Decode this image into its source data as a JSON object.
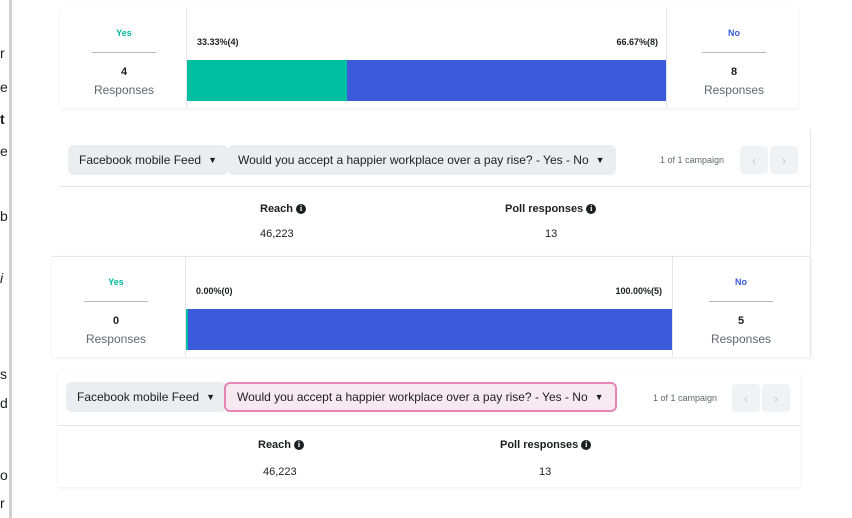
{
  "edge_fragments": [
    "r",
    "e",
    "t",
    "e",
    "b",
    "i",
    "s",
    "d",
    "o",
    "r"
  ],
  "colors": {
    "yes": "#00bfa0",
    "no": "#3b5bdb",
    "highlight_border": "#e685b5"
  },
  "icons": {
    "caret": "caret-down-icon",
    "info": "info-icon",
    "prev": "chevron-left-icon",
    "next": "chevron-right-icon"
  },
  "poll1": {
    "yes_label": "Yes",
    "yes_count": "4",
    "yes_resp": "Responses",
    "no_label": "No",
    "no_count": "8",
    "no_resp": "Responses",
    "yes_pct": "33.33%(4)",
    "no_pct": "66.67%(8)",
    "yes_share": 33.33
  },
  "section1": {
    "placement": "Facebook mobile Feed",
    "question": "Would you accept a happier workplace over a pay rise? - Yes - No",
    "campaign_count": "1 of 1 campaign",
    "reach_label": "Reach",
    "reach_value": "46,223",
    "poll_label": "Poll responses",
    "poll_value": "13"
  },
  "poll2": {
    "yes_label": "Yes",
    "yes_count": "0",
    "yes_resp": "Responses",
    "no_label": "No",
    "no_count": "5",
    "no_resp": "Responses",
    "yes_pct": "0.00%(0)",
    "no_pct": "100.00%(5)",
    "yes_share": 0
  },
  "section2": {
    "placement": "Facebook mobile Feed",
    "question": "Would you accept a happier workplace over a pay rise? - Yes - No",
    "campaign_count": "1 of 1 campaign",
    "reach_label": "Reach",
    "reach_value": "46,223",
    "poll_label": "Poll responses",
    "poll_value": "13"
  }
}
